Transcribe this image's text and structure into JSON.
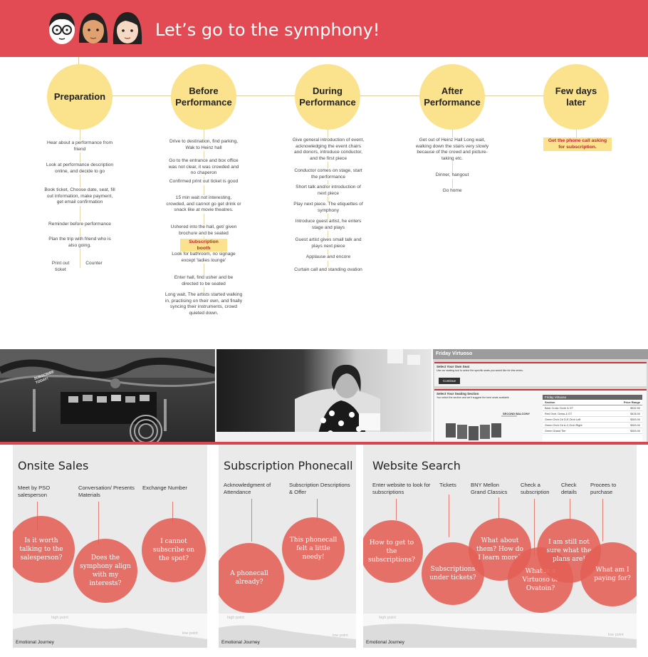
{
  "header": {
    "title": "Let’s go to the symphony!",
    "background": "#e24b54"
  },
  "timeline": {
    "phases": [
      {
        "label": "Preparation"
      },
      {
        "label": "Before Performance"
      },
      {
        "label": "During Performance"
      },
      {
        "label": "After Performance"
      },
      {
        "label": "Few days later"
      }
    ],
    "preparation_steps": [
      "Hear about a performance from friend",
      "Look at performance description online, and decide to go",
      "Book ticket, Choose date, seat, fill out information, make payment, get email confirmation",
      "Reminder before performance",
      "Plan the trip with friend who is also going.",
      "Print out ticket",
      "Counter"
    ],
    "before_steps": [
      "Drive to destination, find parking, Wak to Heinz hall",
      "Go to the entrance and box office was not clear, it was crowded and no chaperon",
      "Confirmed print out ticket is good",
      "15 min wait not interesting, crowded, and cannot go get drink or snack like at movie theatres.",
      "Ushered into the hall, get/ given brochure and be seated",
      "Look for bathroom, no signage except 'ladies lounge'",
      "Enter hall, find usher and be directed to be seated",
      "Long wait, The artists started walking in, practising on their own, and finally syncing their instruments, crowd quieted down."
    ],
    "before_highlight": "Subscription booth",
    "during_steps": [
      "Give general introduction of event, acknowledging the event chairs and donors, introduce conductor, and the first piece",
      "Conductor comes on stage, start the performance",
      "Short talk and/or introduction of next piece",
      "Play next piece. The etiquettes of symphony",
      "Introduce guest artist, he enters stage and plays",
      "Guest artist gives small talk and plays next piece",
      "Applause and encore",
      "Curtain call and standing ovation"
    ],
    "after_steps": [
      "Get out of Heinz Hall Long wait, walking down the stairs very slowly because of the crowd and picture-taking etc.",
      "Dinner, hangout",
      "Go home"
    ],
    "later_highlight": "Get the phone call asking for subscription.",
    "accent": "#fbe38d"
  },
  "photos": {
    "booth_sign": "SUBSCRIBE TODAY!",
    "website_header": "Friday Virtuoso",
    "website_seat_title": "Select Your Own Seat",
    "website_seat_text": "Use our seating tool to select the specific seats you would like for this series.",
    "website_button": "Continue",
    "website_section_title": "Select Your Seating Section",
    "website_section_text": "You select the section and we'll suggest the best seats available",
    "website_table_title": "Friday Virtuoso",
    "website_col_section": "Section",
    "website_col_price": "Price Range",
    "website_balcony": "SECOND BALCONY",
    "website_rows": [
      {
        "section": "Back Cross Circle & GT",
        "price": "$532.50"
      },
      {
        "section": "Red Orch, Dress & GT",
        "price": "$426.00"
      },
      {
        "section": "Green Orch Ctr D-E,Orch Left",
        "price": "$300.00"
      },
      {
        "section": "Green Orch Ctr A-C,Orch Right",
        "price": "$300.00"
      },
      {
        "section": "Green Grand Tier",
        "price": "$300.00"
      }
    ]
  },
  "panels": {
    "onsite": {
      "title": "Onsite Sales",
      "labels": [
        "Meet by PSO salesperson",
        "Conversation/ Presents Materials",
        "Exchange Number"
      ],
      "bubbles": [
        "Is it worth talking to the salesperson?",
        "Does the symphony align with my interests?",
        "I cannot subscribe on the spot?"
      ]
    },
    "phonecall": {
      "title": "Subscription Phonecall",
      "labels": [
        "Acknowledgment of Attendance",
        "Subscription Descriptions & Offer"
      ],
      "bubbles": [
        "A phonecall already?",
        "This phonecall felt a little needy!"
      ]
    },
    "website": {
      "title": "Website Search",
      "labels": [
        "Enter website to look for subscriptions",
        "Tickets",
        "BNY Mellon Grand Classics",
        "Check a subscription",
        "Check details",
        "Procees to purchase"
      ],
      "bubbles": [
        "How to get to the subscriptions?",
        "Subscriptions under tickets?",
        "What about them? How do I learn more?",
        "What is a Virtuoso or Ovatoin?",
        "I am still not sure what the plans are!",
        "What am I paying for?"
      ]
    },
    "journey": {
      "title": "Emotional Journey",
      "high": "high point",
      "low": "low point"
    },
    "bubble_color": "#e25e54"
  }
}
